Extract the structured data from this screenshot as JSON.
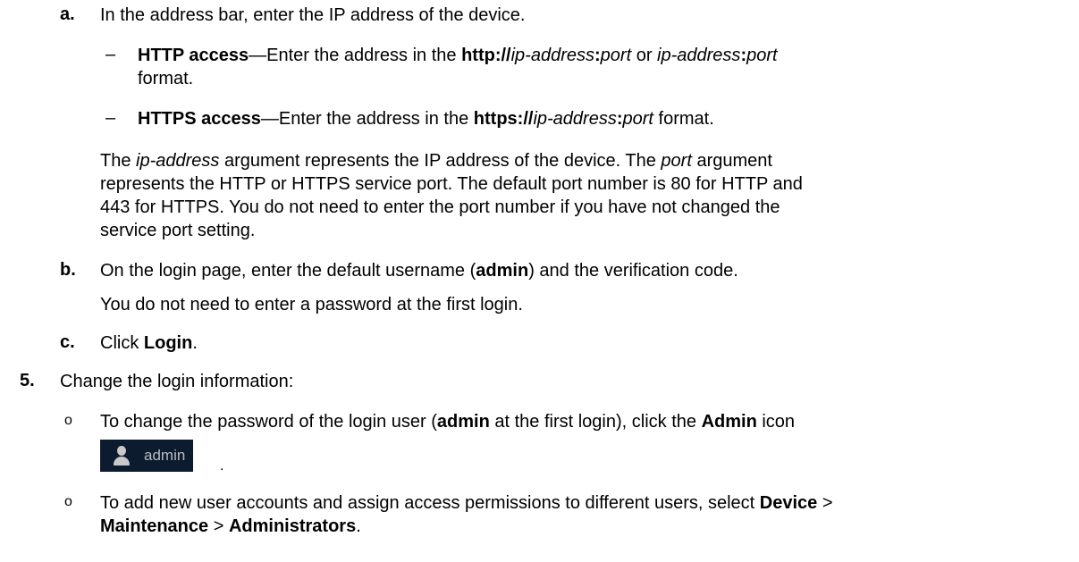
{
  "step_a": {
    "marker": "a.",
    "text": "In the address bar, enter the IP address of the device.",
    "http": {
      "dash": "–",
      "label": "HTTP access",
      "sep": "—Enter the address in the ",
      "proto": "http://",
      "ip": "ip-address",
      "colon": ":",
      "port": "port",
      "or": " or ",
      "ip2": "ip-address",
      "colon2": ":",
      "port2": "port",
      "cont": "format."
    },
    "https": {
      "dash": "–",
      "label": "HTTPS access",
      "sep": "—Enter the address in the ",
      "proto": "https://",
      "ip": "ip-address",
      "colon": ":",
      "port": "port",
      "tail": " format."
    },
    "note": {
      "l1_pre": "The ",
      "l1_ip": "ip-address",
      "l1_mid": " argument represents the IP address of the device. The ",
      "l1_port": "port",
      "l1_post": " argument",
      "l2": "represents the HTTP or HTTPS service port. The default port number is 80 for HTTP and",
      "l3": "443 for HTTPS. You do not need to enter the port number if you have not changed the",
      "l4": "service port setting."
    }
  },
  "step_b": {
    "marker": "b.",
    "pre": "On the login page, enter the default username (",
    "user": "admin",
    "post": ") and the verification code.",
    "note": "You do not need to enter a password at the first login."
  },
  "step_c": {
    "marker": "c.",
    "pre": "Click ",
    "bold": "Login",
    "post": "."
  },
  "step5": {
    "marker": "5.",
    "text": "Change the login information:",
    "bullet1": {
      "glyph": "o",
      "pre": "To change the password of the login user (",
      "user": "admin",
      "mid": " at the first login), click the ",
      "bold": "Admin",
      "post": " icon",
      "icon_label": "admin",
      "after_icon": "."
    },
    "bullet2": {
      "glyph": "o",
      "l1_pre": "To add new user accounts and assign access permissions to different users, select ",
      "l1_bold": "Device",
      "l1_sep": " >",
      "l2_b1": "Maintenance",
      "l2_sep": " > ",
      "l2_b2": "Administrators",
      "l2_end": "."
    }
  }
}
